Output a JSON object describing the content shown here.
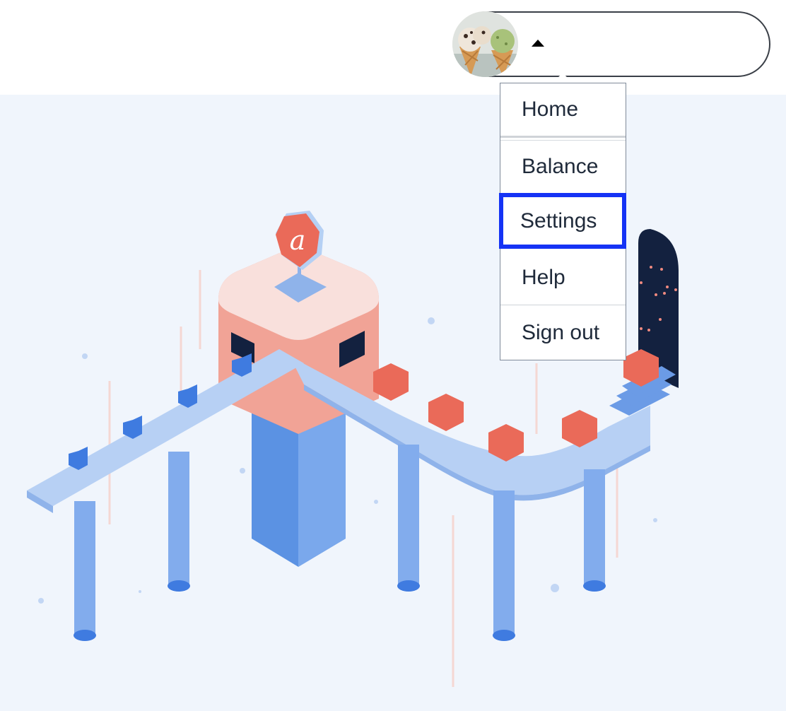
{
  "header": {
    "avatar_alt": "ice-cream-avatar",
    "account_toggle_icon": "caret-up-icon"
  },
  "menu": {
    "items": [
      {
        "label": "Home"
      },
      {
        "label": "Balance"
      },
      {
        "label": "Settings",
        "focused": true
      },
      {
        "label": "Help"
      },
      {
        "label": "Sign out"
      }
    ]
  },
  "colors": {
    "accent_focus": "#1533f5",
    "hero_bg": "#f0f5fc",
    "conveyor_blue": "#b7d0f4",
    "pillar_blue": "#5b92e3",
    "hex_red": "#ea6a59",
    "dark_navy": "#13213f"
  }
}
